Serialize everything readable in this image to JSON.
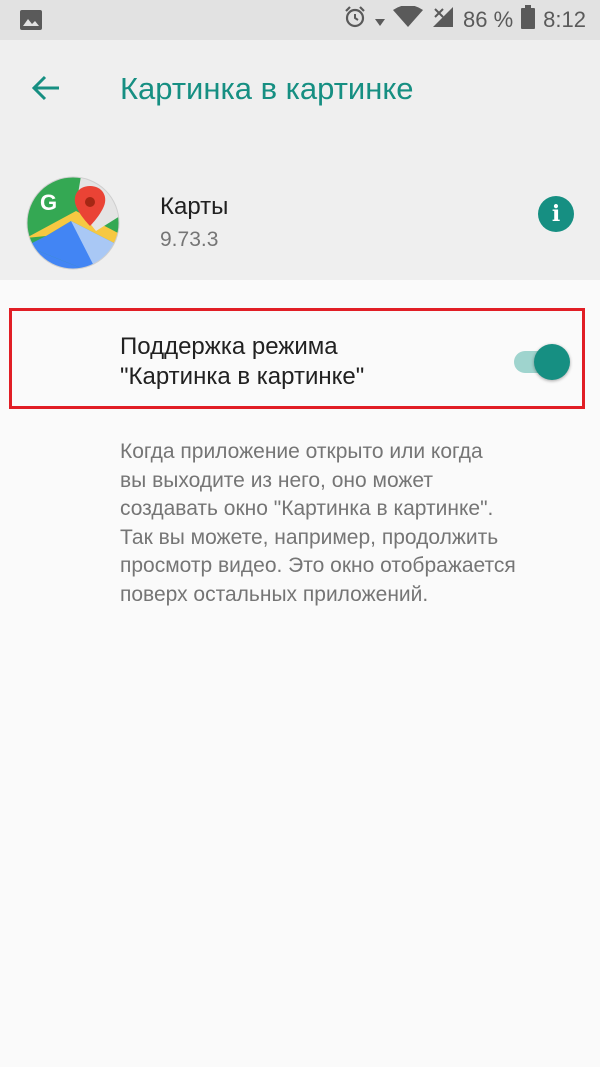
{
  "status_bar": {
    "battery": "86 %",
    "time": "8:12",
    "icons": [
      "gallery-icon",
      "alarm-icon",
      "signal-icon",
      "wifi-icon",
      "no-sim-icon",
      "battery-icon"
    ]
  },
  "header": {
    "title": "Картинка в картинке",
    "back_icon": "arrow-left-icon"
  },
  "app": {
    "name": "Карты",
    "version": "9.73.3",
    "icon": "google-maps-icon",
    "info_icon": "info-icon",
    "info_glyph": "i"
  },
  "setting": {
    "label": "Поддержка режима\n\"Картинка в картинке\"",
    "enabled": true
  },
  "description": "Когда приложение открыто или когда\nвы выходите из него, оно может\nсоздавать окно \"Картинка в картинке\".\nТак вы можете, например, продолжить\nпросмотр видео. Это окно отображается\nповерх остальных приложений.",
  "colors": {
    "accent": "#168f82",
    "highlight_border": "#e11e25",
    "toggle_track": "#9fd4ce"
  }
}
